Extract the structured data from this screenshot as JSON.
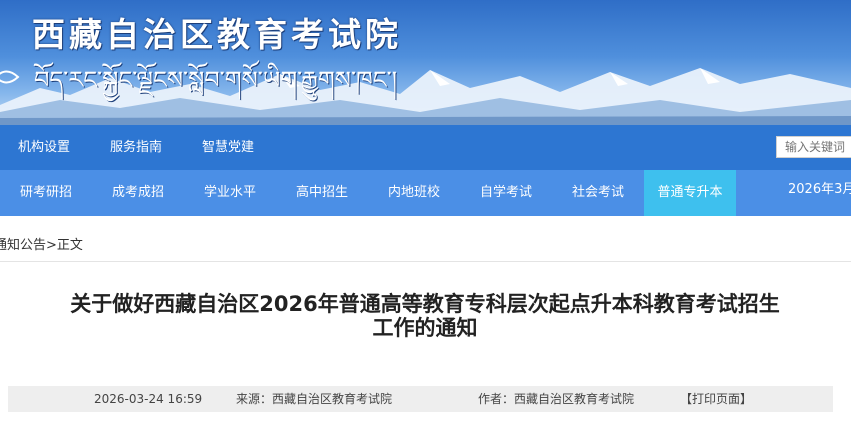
{
  "header": {
    "site_title": "西藏自治区教育考试院",
    "site_title_tibetan": "བོད་རང་སྐྱོང་ལྗོངས་སློབ་གསོ་ཡིག་རྒྱུགས་ཁང་།"
  },
  "nav_primary": {
    "items": [
      "机构设置",
      "服务指南",
      "智慧党建"
    ],
    "search_placeholder": "输入关键词"
  },
  "nav_secondary": {
    "items": [
      "研考研招",
      "成考成招",
      "学业水平",
      "高中招生",
      "内地班校",
      "自学考试",
      "社会考试",
      "普通专升本"
    ],
    "active": "普通专升本",
    "date": "2026年3月"
  },
  "breadcrumb": {
    "section": "通知公告",
    "separator": ">",
    "current": "正文"
  },
  "article": {
    "title_line1": "关于做好西藏自治区2026年普通高等教育专科层次起点升本科教育考试招生",
    "title_line2": "工作的通知",
    "date": "2026-03-24 16:59",
    "source": "来源：西藏自治区教育考试院",
    "author": "作者：西藏自治区教育考试院",
    "print_label": "【打印页面】"
  },
  "colors": {
    "nav_primary_bg": "#2d76d2",
    "nav_secondary_bg": "#4b8fe6",
    "nav_active_bg": "#3ec0ee"
  }
}
